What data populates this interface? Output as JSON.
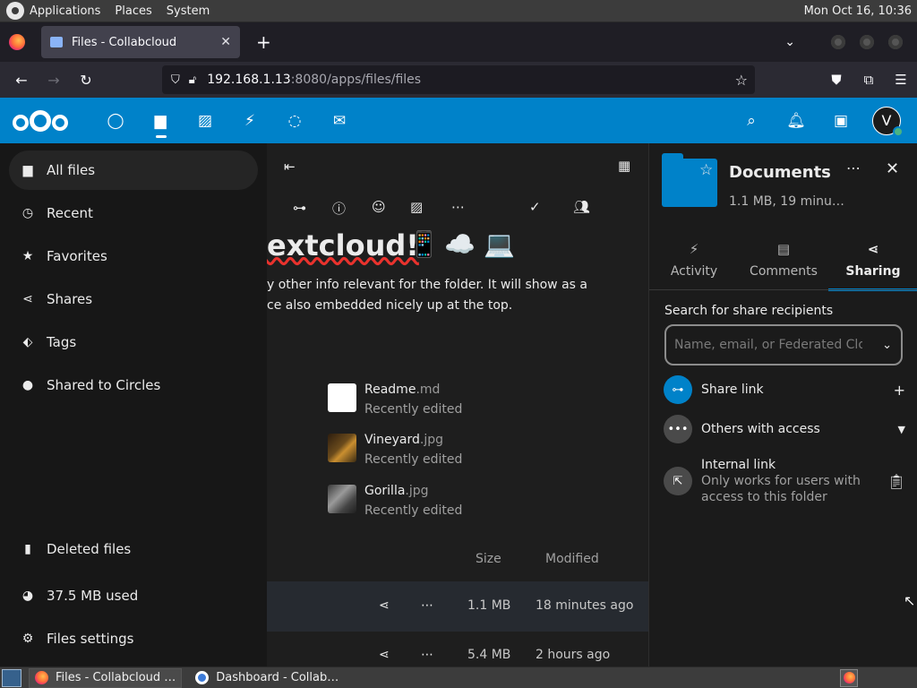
{
  "desktop": {
    "menu": [
      "Applications",
      "Places",
      "System"
    ],
    "clock": "Mon Oct 16, 10:36"
  },
  "browser": {
    "tab_title": "Files - Collabcloud",
    "url_host": "192.168.1.13",
    "url_path": ":8080/apps/files/files"
  },
  "nc_header": {
    "apps": [
      "dashboard-icon",
      "files-icon",
      "photos-icon",
      "activity-icon",
      "talk-icon",
      "mail-icon"
    ],
    "avatar_letter": "V"
  },
  "nav": {
    "items": [
      "All files",
      "Recent",
      "Favorites",
      "Shares",
      "Tags",
      "Shared to Circles"
    ],
    "deleted": "Deleted files",
    "quota": "37.5 MB used",
    "settings": "Files settings"
  },
  "folder": {
    "rich_title": "extcloud!",
    "rich_emoji": [
      "📱",
      "☁️",
      "💻"
    ],
    "desc_line1": "y other info relevant for the folder. It will show as a",
    "desc_line2": "ce also embedded nicely up at the top.",
    "recent_files": [
      {
        "name": "Readme",
        "ext": ".md",
        "sub": "Recently edited"
      },
      {
        "name": "Vineyard",
        "ext": ".jpg",
        "sub": "Recently edited"
      },
      {
        "name": "Gorilla",
        "ext": ".jpg",
        "sub": "Recently edited"
      }
    ],
    "columns": {
      "size": "Size",
      "modified": "Modified"
    },
    "rows": [
      {
        "size": "1.1 MB",
        "modified": "18 minutes ago"
      },
      {
        "size": "5.4 MB",
        "modified": "2 hours ago"
      }
    ]
  },
  "sidebar": {
    "title": "Documents",
    "meta": "1.1 MB, 19 minu…",
    "tabs": [
      "Activity",
      "Comments",
      "Sharing"
    ],
    "search_label": "Search for share recipients",
    "search_placeholder": "Name, email, or Federated Cloud ID …",
    "share_link": "Share link",
    "others": "Others with access",
    "internal_title": "Internal link",
    "internal_sub1": "Only works for users with",
    "internal_sub2": "access to this folder"
  },
  "taskbar": {
    "items": [
      "Files - Collabcloud …",
      "Dashboard - Collab…"
    ]
  }
}
